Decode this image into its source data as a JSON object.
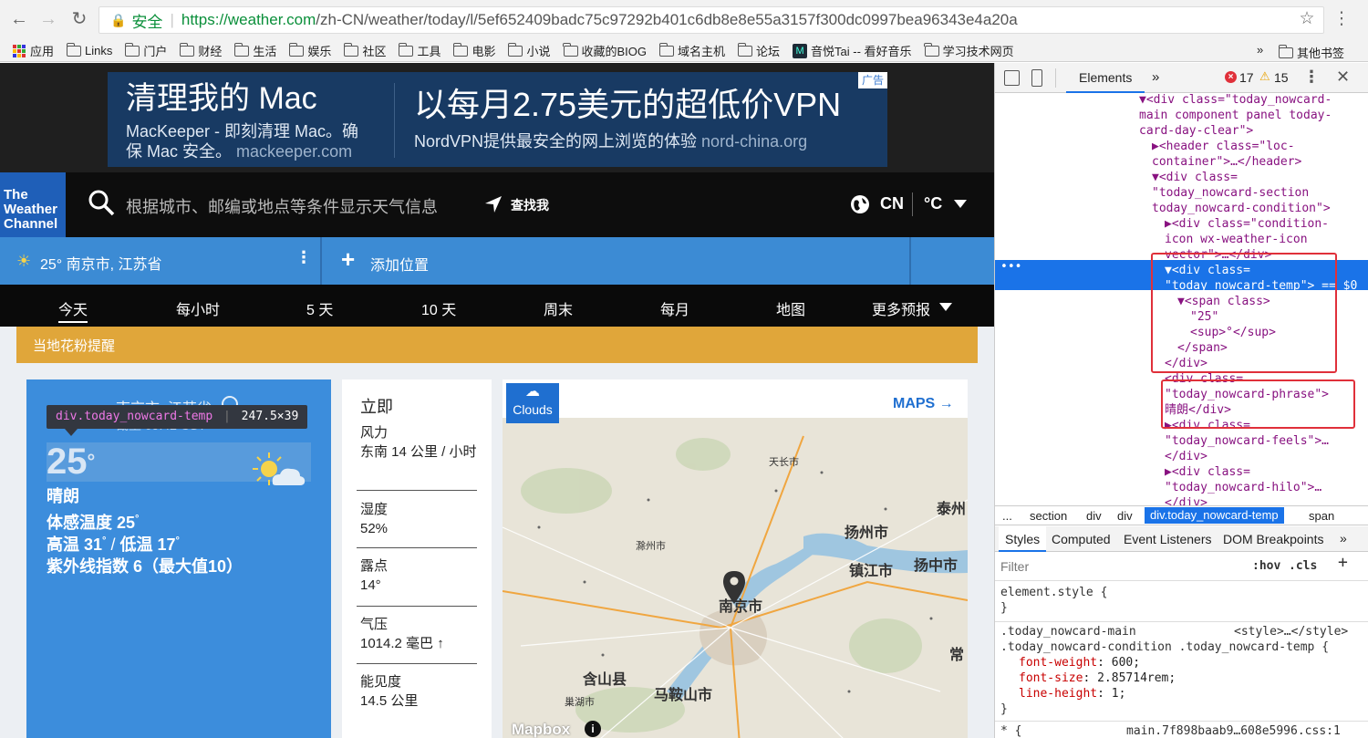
{
  "browser": {
    "secure_label": "安全",
    "url_host": "https://weather.com",
    "url_path": "/zh-CN/weather/today/l/5ef652409badc75c97292b401c6db8e8e55a3157f300dc0997bea96343e4a20a",
    "bookmarks": [
      "应用",
      "Links",
      "门户",
      "财经",
      "生活",
      "娱乐",
      "社区",
      "工具",
      "电影",
      "小说",
      "收藏的BIOG",
      "域名主机",
      "论坛",
      "音悦Tai -- 看好音乐",
      "学习技术网页"
    ],
    "bookmarks_more": "»",
    "other_bookmarks": "其他书签"
  },
  "ad": {
    "left_title": "清理我的 Mac",
    "left_line1": "MacKeeper - 即刻清理 Mac。确",
    "left_line2": "保 Mac 安全。",
    "left_domain": "mackeeper.com",
    "right_title": "以每月2.75美元的超低价VPN",
    "right_sub": "NordVPN提供最安全的网上浏览的体验",
    "right_domain": "nord-china.org",
    "badge": "广告"
  },
  "header": {
    "logo_line1": "The",
    "logo_line2": "Weather",
    "logo_line3": "Channel",
    "search_placeholder": "根据城市、邮编或地点等条件显示天气信息",
    "locate_me": "查找我",
    "region": "CN",
    "unit": "°C"
  },
  "location_bar": {
    "current": "25° 南京市, 江苏省",
    "add_location": "添加位置"
  },
  "nav": [
    "今天",
    "每小时",
    "5 天",
    "10 天",
    "周末",
    "每月",
    "地图",
    "更多预报"
  ],
  "alert": "当地花粉提醒",
  "nowcard": {
    "location": "南京市, 江苏省",
    "time_partial": "截至 09:42 CST",
    "temp": "25",
    "degree": "°",
    "phrase": "晴朗",
    "feels_label": "体感温度",
    "feels_value": "25",
    "high_label": "高温",
    "high_value": "31",
    "low_label": "低温",
    "low_value": "17",
    "uv": "紫外线指数 6（最大值10）",
    "inspector_tooltip_selector": "div.today_nowcard-temp",
    "inspector_tooltip_size": "247.5×39"
  },
  "details": {
    "header": "立即",
    "wind_label": "风力",
    "wind_value": "东南 14 公里 / 小时",
    "humidity_label": "湿度",
    "humidity_value": "52%",
    "dew_label": "露点",
    "dew_value": "14°",
    "pressure_label": "气压",
    "pressure_value": "1014.2 毫巴 ↑",
    "visibility_label": "能见度",
    "visibility_value": "14.5 公里"
  },
  "map": {
    "layer_label": "Clouds",
    "maps_link": "MAPS →",
    "places": [
      "天长市",
      "扬州市",
      "泰州",
      "滁州市",
      "镇江市",
      "扬中市",
      "南京市",
      "含山县",
      "马鞍山市",
      "巢湖市",
      "常"
    ],
    "attribution": "Mapbox"
  },
  "devtools": {
    "tab_elements": "Elements",
    "more_tabs": "»",
    "error_count": "17",
    "warning_count": "15",
    "tree": [
      {
        "id": "l0",
        "text": "▼<div class=\"today_nowcard-"
      },
      {
        "id": "l1",
        "text": "main component panel today-"
      },
      {
        "id": "l2",
        "text": "card-day-clear\">"
      },
      {
        "id": "l3",
        "text": "▶<header class=\"loc-"
      },
      {
        "id": "l4",
        "text": "container\">…</header>"
      },
      {
        "id": "l5",
        "text": "▼<div class="
      },
      {
        "id": "l6",
        "text": "\"today_nowcard-section"
      },
      {
        "id": "l7",
        "text": "today_nowcard-condition\">"
      },
      {
        "id": "l8",
        "text": "▶<div class=\"condition-"
      },
      {
        "id": "l9",
        "text": "icon wx-weather-icon"
      },
      {
        "id": "l10",
        "text": "vector\">…</div>"
      },
      {
        "id": "l11",
        "text": "▼<div class="
      },
      {
        "id": "l12",
        "text": "\"today_nowcard-temp\"> == $0"
      },
      {
        "id": "l13",
        "text": "▼<span class>"
      },
      {
        "id": "l14",
        "text": "\"25\""
      },
      {
        "id": "l15",
        "text": "<sup>°</sup>"
      },
      {
        "id": "l16",
        "text": "</span>"
      },
      {
        "id": "l17",
        "text": "</div>"
      },
      {
        "id": "l18",
        "text": "<div class="
      },
      {
        "id": "l19",
        "text": "\"today_nowcard-phrase\">"
      },
      {
        "id": "l20",
        "text": "晴朗</div>"
      },
      {
        "id": "l21",
        "text": "▶<div class="
      },
      {
        "id": "l22",
        "text": "\"today_nowcard-feels\">…"
      },
      {
        "id": "l23",
        "text": "</div>"
      },
      {
        "id": "l24",
        "text": "▶<div class="
      },
      {
        "id": "l25",
        "text": "\"today_nowcard-hilo\">…"
      },
      {
        "id": "l26",
        "text": "</div>"
      }
    ],
    "breadcrumb": [
      "...",
      "section",
      "div",
      "div",
      "div.today_nowcard-temp",
      "span"
    ],
    "style_tabs": [
      "Styles",
      "Computed",
      "Event Listeners",
      "DOM Breakpoints",
      "»"
    ],
    "filter_placeholder": "Filter",
    "hov": ":hov",
    "cls": ".cls",
    "plus": "+",
    "element_style": "element.style {",
    "close_brace": "}",
    "rule_selector_1": ".today_nowcard-main",
    "rule_source": "<style>…</style>",
    "rule_selector_2": ".today_nowcard-condition .today_nowcard-temp {",
    "prop1_name": "font-weight",
    "prop1_value": "600;",
    "prop2_name": "font-size",
    "prop2_value": "2.85714rem;",
    "prop3_name": "line-height",
    "prop3_value": "1;",
    "next_rule": "* {",
    "next_source": "main.7f898baab9…608e5996.css:1"
  }
}
